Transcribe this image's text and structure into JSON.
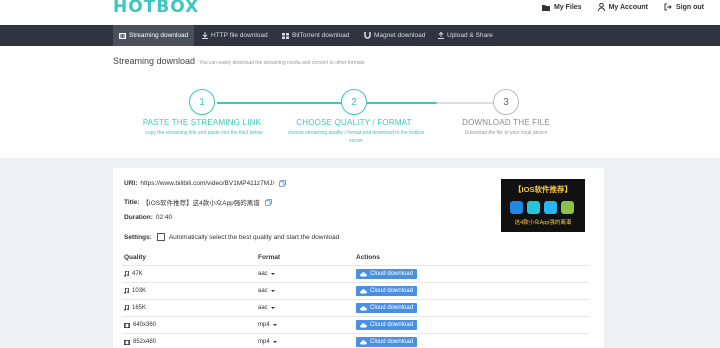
{
  "brand": {
    "logo": "HOTBOX"
  },
  "top_links": [
    {
      "label": "My Files",
      "icon": "folder-icon"
    },
    {
      "label": "My Account",
      "icon": "user-icon"
    },
    {
      "label": "Sign out",
      "icon": "signout-icon"
    }
  ],
  "nav": [
    {
      "label": "Streaming download",
      "icon": "film-icon",
      "active": true
    },
    {
      "label": "HTTP file download",
      "icon": "download-icon",
      "active": false
    },
    {
      "label": "BitTorrent download",
      "icon": "bittorrent-icon",
      "active": false
    },
    {
      "label": "Magnet download",
      "icon": "magnet-icon",
      "active": false
    },
    {
      "label": "Upload & Share",
      "icon": "upload-icon",
      "active": false
    }
  ],
  "page": {
    "title": "Streaming download",
    "subtitle": "You can easily download the streaming media and convert to other formats"
  },
  "steps": [
    {
      "number": "1",
      "title": "PASTE THE STREAMING LINK",
      "desc": "copy the streaming link and paste into the field below",
      "done": true
    },
    {
      "number": "2",
      "title": "CHOOSE QUALITY / FORMAT",
      "desc": "choose streaming quality / format and download to the hotbox server",
      "done": true
    },
    {
      "number": "3",
      "title": "DOWNLOAD THE FILE",
      "desc": "Download the file to your local device",
      "done": false
    }
  ],
  "media": {
    "uri_label": "URI:",
    "uri_value": "https://www.bilibili.com/video/BV1MP411z7MJ/",
    "title_label": "Title:",
    "title_value": "【IOS软件推荐】这4款小众App强的离谱",
    "duration_label": "Duration:",
    "duration_value": "02:40",
    "settings_label": "Settings:",
    "settings_text": "Automatically select the best quality and start the download",
    "auto_select_checked": false
  },
  "thumbnail": {
    "title": "【IOS软件推荐】",
    "caption": "这4款小众App强的离谱",
    "icon_colors": [
      "#1e88e5",
      "#26c6da",
      "#29b6f6",
      "#8bc34a"
    ]
  },
  "table": {
    "headers": {
      "quality": "Quality",
      "format": "Format",
      "actions": "Actions"
    },
    "rows": [
      {
        "quality": "47K",
        "kind": "audio",
        "format": "aac",
        "action": "Cloud download"
      },
      {
        "quality": "103K",
        "kind": "audio",
        "format": "aac",
        "action": "Cloud download"
      },
      {
        "quality": "165K",
        "kind": "audio",
        "format": "aac",
        "action": "Cloud download"
      },
      {
        "quality": "640x360",
        "kind": "video",
        "format": "mp4",
        "action": "Cloud download"
      },
      {
        "quality": "852x480",
        "kind": "video",
        "format": "mp4",
        "action": "Cloud download"
      }
    ]
  },
  "colors": {
    "accent": "#3cc7c0",
    "nav_bg": "#2f3440",
    "button": "#4a90e2"
  }
}
